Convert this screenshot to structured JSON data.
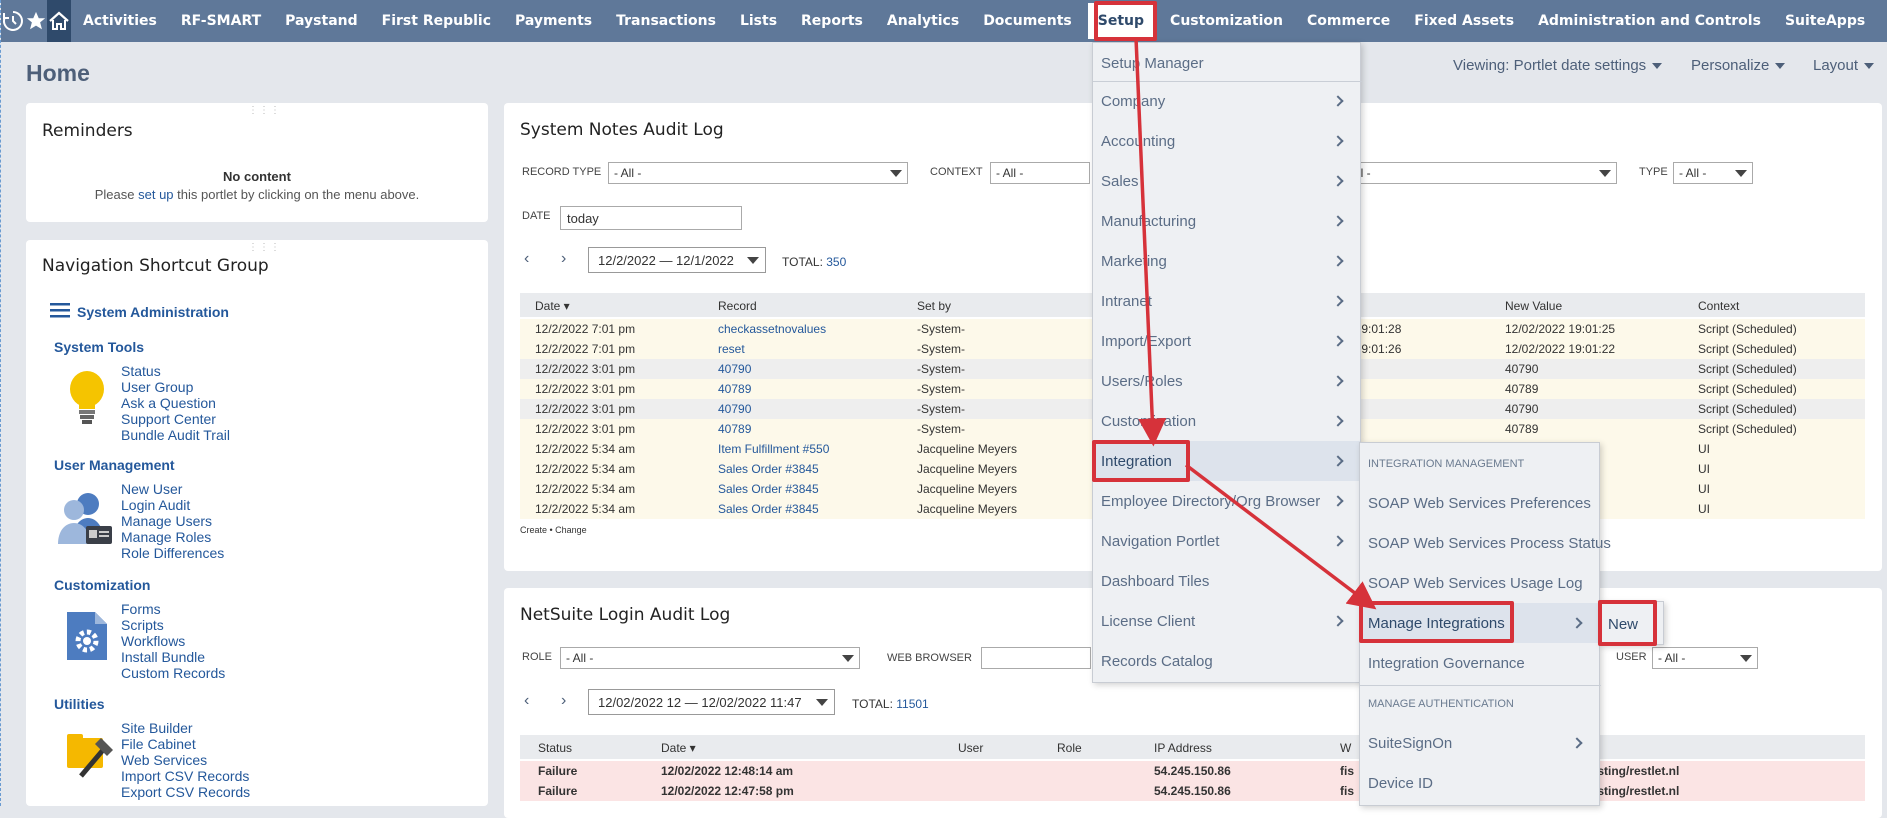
{
  "nav": {
    "icons": [
      "recent-icon",
      "star-icon",
      "home-icon"
    ],
    "items": [
      "Activities",
      "RF-SMART",
      "Paystand",
      "First Republic",
      "Payments",
      "Transactions",
      "Lists",
      "Reports",
      "Analytics",
      "Documents",
      "Setup",
      "Customization",
      "Commerce",
      "Fixed Assets",
      "Administration and Controls",
      "SuiteApps"
    ],
    "more": "..."
  },
  "page": {
    "title": "Home",
    "viewing": "Viewing: Portlet date settings",
    "personalize": "Personalize",
    "layout": "Layout"
  },
  "reminders": {
    "title": "Reminders",
    "no_content": "No content",
    "hint_pre": "Please ",
    "hint_link": "set up",
    "hint_post": " this portlet by clicking on the menu above."
  },
  "shortcuts": {
    "title": "Navigation Shortcut Group",
    "group": "System Administration",
    "categories": [
      {
        "label": "System Tools",
        "icon": "lightbulb-icon",
        "links": [
          "Status",
          "User Group",
          "Ask a Question",
          "Support Center",
          "Bundle Audit Trail"
        ]
      },
      {
        "label": "User Management",
        "icon": "users-icon",
        "links": [
          "New User",
          "Login Audit",
          "Manage Users",
          "Manage Roles",
          "Role Differences"
        ]
      },
      {
        "label": "Customization",
        "icon": "gear-document-icon",
        "links": [
          "Forms",
          "Scripts",
          "Workflows",
          "Install Bundle",
          "Custom Records"
        ]
      },
      {
        "label": "Utilities",
        "icon": "tools-icon",
        "links": [
          "Site Builder",
          "File Cabinet",
          "Web Services",
          "Import CSV Records",
          "Export CSV Records"
        ]
      }
    ]
  },
  "audit": {
    "title": "System Notes Audit Log",
    "record_type_label": "RECORD TYPE",
    "record_type_value": "- All -",
    "context_label": "CONTEXT",
    "context_value": "- All -",
    "hidden_select_value": "ll -",
    "type_label": "TYPE",
    "type_value": "- All -",
    "date_label": "DATE",
    "date_value": "today",
    "range": "12/2/2022 — 12/1/2022",
    "total_label": "TOTAL:",
    "total": "350",
    "columns": [
      "Date ▾",
      "Record",
      "Set by",
      "e",
      "New Value",
      "Context"
    ],
    "rows": [
      [
        "12/2/2022 7:01 pm",
        "checkassetnovalues",
        "-System-",
        "22 19:01:28",
        "12/02/2022 19:01:25",
        "Script (Scheduled)"
      ],
      [
        "12/2/2022 7:01 pm",
        "reset",
        "-System-",
        "22 19:01:26",
        "12/02/2022 19:01:22",
        "Script (Scheduled)"
      ],
      [
        "12/2/2022 3:01 pm",
        "40790",
        "-System-",
        "",
        "40790",
        "Script (Scheduled)"
      ],
      [
        "12/2/2022 3:01 pm",
        "40789",
        "-System-",
        "",
        "40789",
        "Script (Scheduled)"
      ],
      [
        "12/2/2022 3:01 pm",
        "40790",
        "-System-",
        "",
        "40790",
        "Script (Scheduled)"
      ],
      [
        "12/2/2022 3:01 pm",
        "40789",
        "-System-",
        "",
        "40789",
        "Script (Scheduled)"
      ],
      [
        "12/2/2022 5:34 am",
        "Item Fulfillment #550",
        "Jacqueline Meyers",
        "",
        "",
        "UI"
      ],
      [
        "12/2/2022 5:34 am",
        "Sales Order #3845",
        "Jacqueline Meyers",
        "",
        "",
        "UI"
      ],
      [
        "12/2/2022 5:34 am",
        "Sales Order #3845",
        "Jacqueline Meyers",
        "",
        "",
        "UI"
      ],
      [
        "12/2/2022 5:34 am",
        "Sales Order #3845",
        "Jacqueline Meyers",
        "",
        "",
        "UI"
      ]
    ],
    "legend": "Create • Change"
  },
  "login": {
    "title": "NetSuite Login Audit Log",
    "role_label": "ROLE",
    "role_value": "- All -",
    "browser_label": "WEB BROWSER",
    "user_label": "USER",
    "user_value": "- All -",
    "range": "12/02/2022 12 — 12/02/2022 11:47",
    "total_label": "TOTAL:",
    "total": "11501",
    "columns": [
      "Status",
      "Date ▾",
      "User",
      "Role",
      "IP Address",
      "W",
      "l"
    ],
    "rows": [
      [
        "Failure",
        "12/02/2022 12:48:14 am",
        "",
        "",
        "54.245.150.86",
        "fis",
        "osting/restlet.nl"
      ],
      [
        "Failure",
        "12/02/2022 12:47:58 pm",
        "",
        "",
        "54.245.150.86",
        "fis",
        "osting/restlet.nl"
      ]
    ]
  },
  "setup_menu": [
    "Setup Manager",
    "Company",
    "Accounting",
    "Sales",
    "Manufacturing",
    "Marketing",
    "Intranet",
    "Import/Export",
    "Users/Roles",
    "Customization",
    "Integration",
    "Employee Directory/Org Browser",
    "Navigation Portlet",
    "Dashboard Tiles",
    "License Client",
    "Records Catalog"
  ],
  "integration_menu": {
    "header1": "INTEGRATION MANAGEMENT",
    "items1": [
      "SOAP Web Services Preferences",
      "SOAP Web Services Process Status",
      "SOAP Web Services Usage Log",
      "Manage Integrations",
      "Integration Governance"
    ],
    "header2": "MANAGE AUTHENTICATION",
    "items2": [
      "SuiteSignOn",
      "Device ID"
    ]
  },
  "manage_menu": [
    "New"
  ],
  "colors": {
    "nav": "#5f7899",
    "accent": "#d6323a",
    "link": "#24589b"
  }
}
